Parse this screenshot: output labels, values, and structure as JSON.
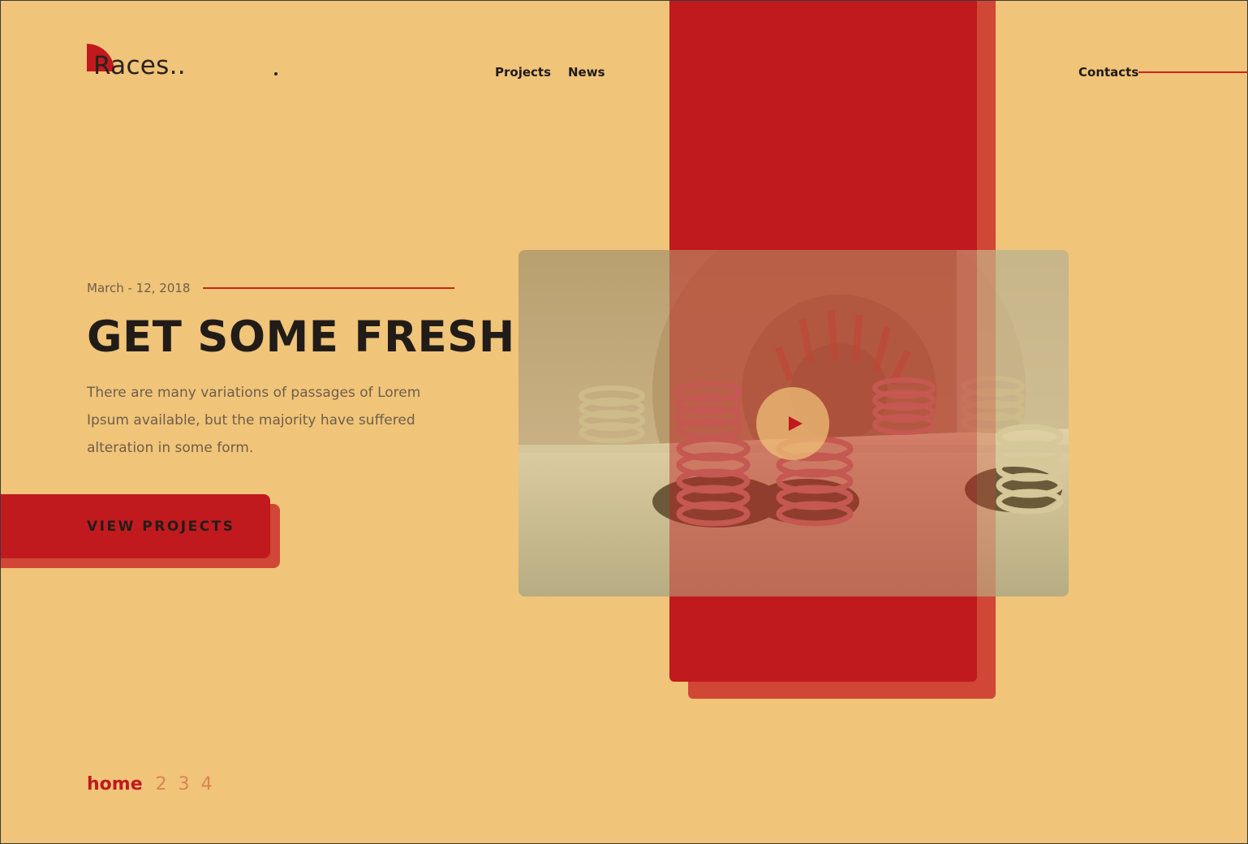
{
  "brand": {
    "name": "Races..",
    "accent": "#c01a1f",
    "background": "#f0c479"
  },
  "nav": {
    "items": [
      "Projects",
      "News"
    ],
    "contacts": "Contacts"
  },
  "hero": {
    "date": "March - 12, 2018",
    "title": "GET SOME FRESH",
    "description": "There are many variations of passages of Lorem Ipsum available, but the majority have suffered alteration in some form.",
    "cta": "VIEW PROJECTS"
  },
  "video": {
    "play_icon": "play-icon"
  },
  "pager": {
    "items": [
      "home",
      "2",
      "3",
      "4"
    ],
    "active": "home"
  }
}
